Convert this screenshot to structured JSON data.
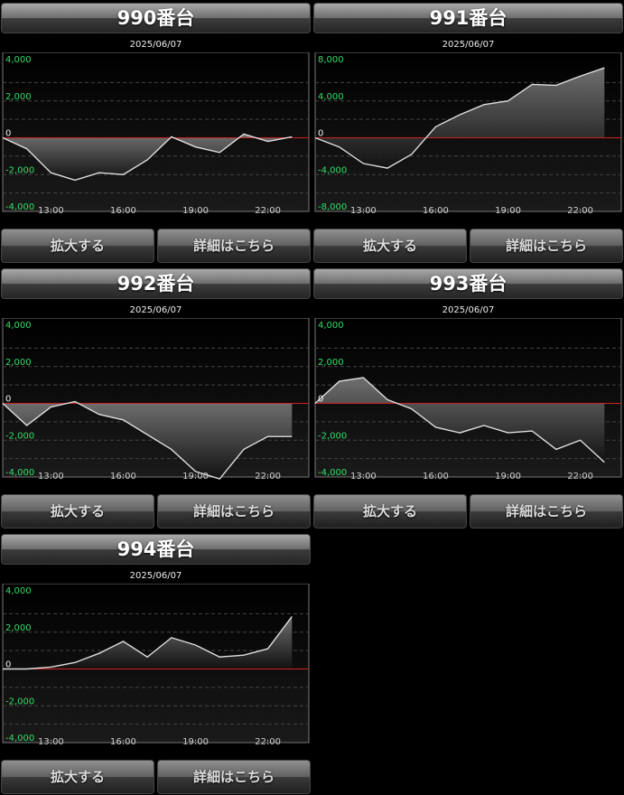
{
  "date": "2025/06/07",
  "buttons": {
    "zoom": "拡大する",
    "detail": "詳細はこちら"
  },
  "colors": {
    "positive_tick": "#33dd66",
    "zero_line": "#cc2222",
    "line": "#dddddd",
    "x_tick": "#cccccc"
  },
  "machines": [
    {
      "title": "990番台",
      "chart_data": {
        "type": "area",
        "x_ticks": [
          "13:00",
          "16:00",
          "19:00",
          "22:00"
        ],
        "y_ticks": [
          4000,
          2000,
          0,
          -2000,
          -4000
        ],
        "ylim": [
          -4000,
          4000
        ],
        "x": [
          11,
          12,
          13,
          14,
          15,
          16,
          17,
          18,
          19,
          20,
          21,
          22,
          23
        ],
        "values": [
          0,
          -600,
          -1900,
          -2300,
          -1900,
          -2000,
          -1200,
          50,
          -500,
          -800,
          200,
          -200,
          50
        ]
      }
    },
    {
      "title": "991番台",
      "chart_data": {
        "type": "area",
        "x_ticks": [
          "13:00",
          "16:00",
          "19:00",
          "22:00"
        ],
        "y_ticks": [
          8000,
          4000,
          0,
          -4000,
          -8000
        ],
        "ylim": [
          -8000,
          8000
        ],
        "x": [
          11,
          12,
          13,
          14,
          15,
          16,
          17,
          18,
          19,
          20,
          21,
          22,
          23
        ],
        "values": [
          0,
          -1000,
          -2800,
          -3300,
          -1800,
          1200,
          2500,
          3600,
          4000,
          5800,
          5700,
          6700,
          7600
        ]
      }
    },
    {
      "title": "992番台",
      "chart_data": {
        "type": "area",
        "x_ticks": [
          "13:00",
          "16:00",
          "19:00",
          "22:00"
        ],
        "y_ticks": [
          4000,
          2000,
          0,
          -2000,
          -4000
        ],
        "ylim": [
          -4000,
          4000
        ],
        "x": [
          11,
          12,
          13,
          14,
          15,
          16,
          17,
          18,
          19,
          20,
          21,
          22,
          23
        ],
        "values": [
          0,
          -1200,
          -200,
          100,
          -600,
          -900,
          -1700,
          -2500,
          -3700,
          -4100,
          -2500,
          -1800,
          -1800
        ]
      }
    },
    {
      "title": "993番台",
      "chart_data": {
        "type": "area",
        "x_ticks": [
          "13:00",
          "16:00",
          "19:00",
          "22:00"
        ],
        "y_ticks": [
          4000,
          2000,
          0,
          -2000,
          -4000
        ],
        "ylim": [
          -4000,
          4000
        ],
        "x": [
          11,
          12,
          13,
          14,
          15,
          16,
          17,
          18,
          19,
          20,
          21,
          22,
          23
        ],
        "values": [
          0,
          1200,
          1400,
          200,
          -300,
          -1300,
          -1600,
          -1200,
          -1600,
          -1500,
          -2500,
          -2000,
          -3200
        ]
      }
    },
    {
      "title": "994番台",
      "chart_data": {
        "type": "area",
        "x_ticks": [
          "13:00",
          "16:00",
          "19:00",
          "22:00"
        ],
        "y_ticks": [
          4000,
          2000,
          0,
          -2000,
          -4000
        ],
        "ylim": [
          -4000,
          4000
        ],
        "x": [
          11,
          12,
          13,
          14,
          15,
          16,
          17,
          18,
          19,
          20,
          21,
          22,
          23
        ],
        "values": [
          0,
          0,
          100,
          350,
          850,
          1500,
          650,
          1700,
          1300,
          650,
          750,
          1100,
          2850
        ]
      }
    }
  ]
}
